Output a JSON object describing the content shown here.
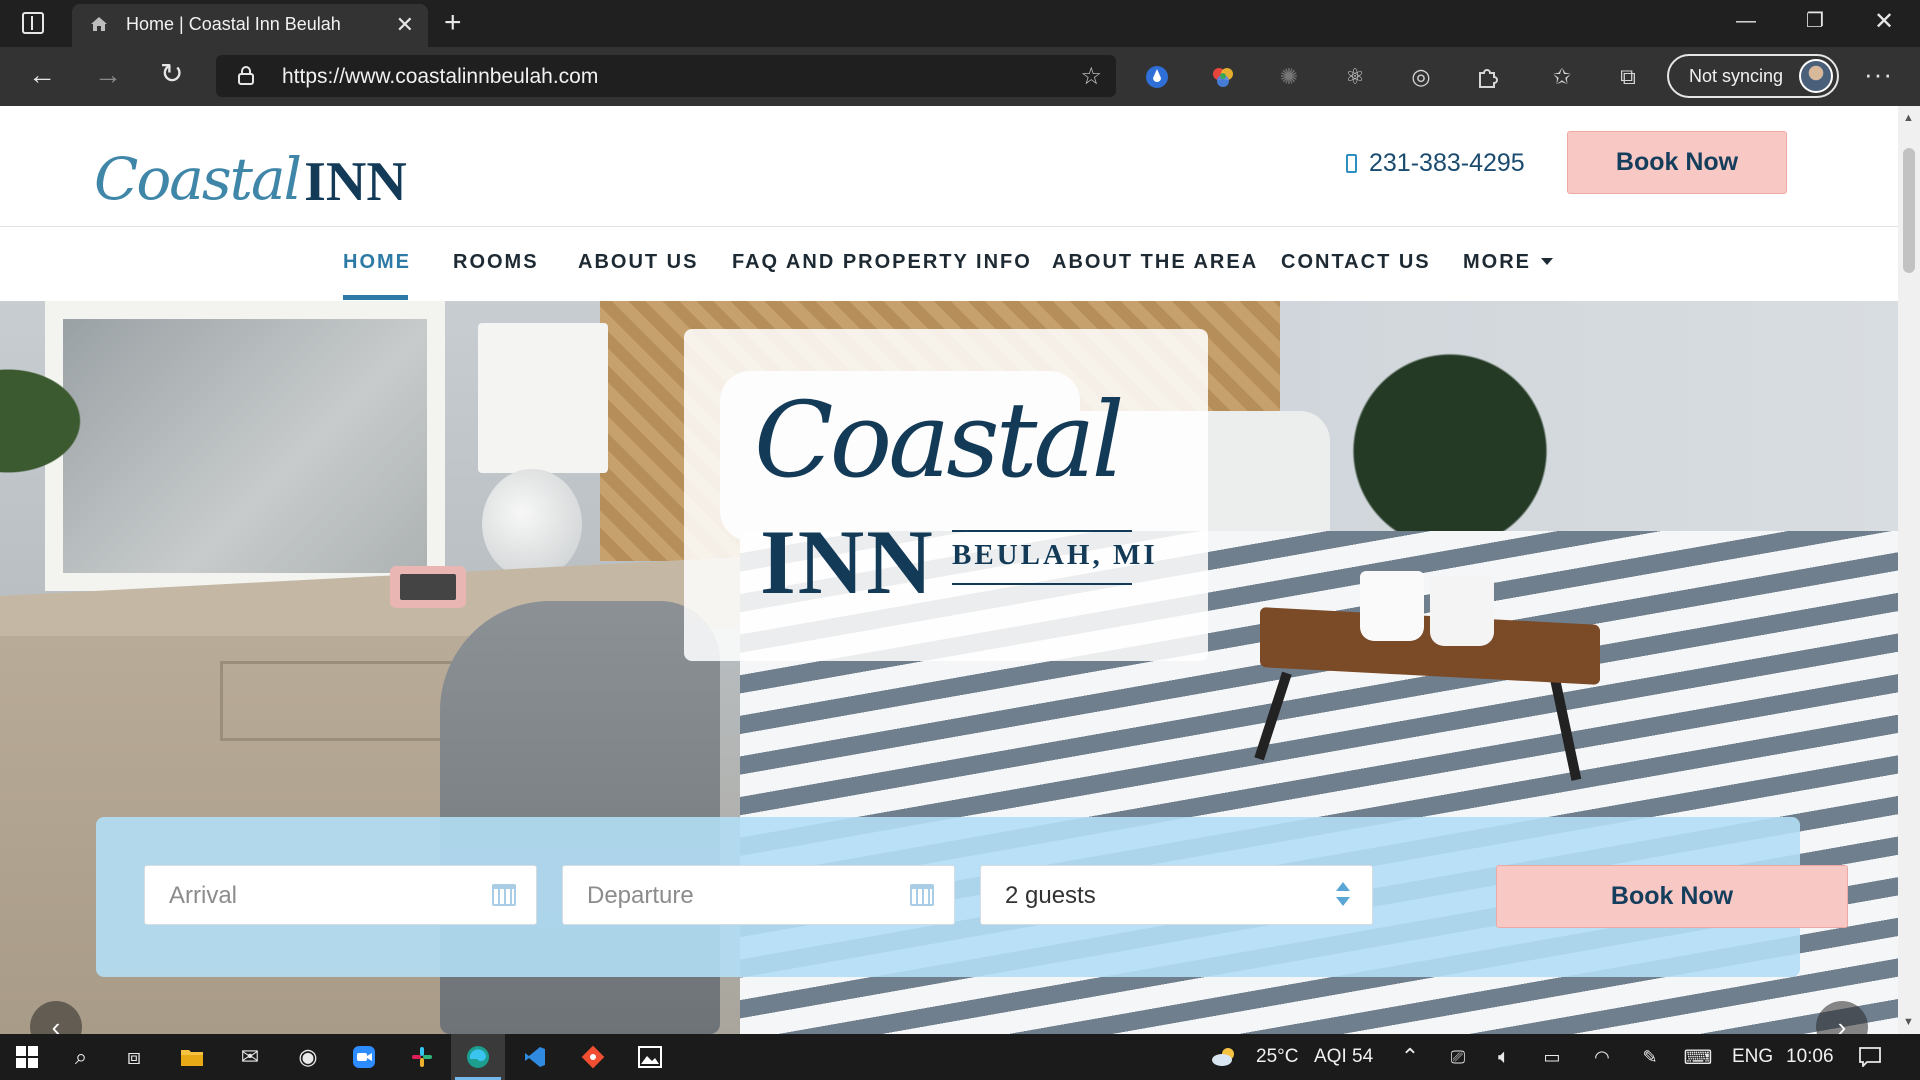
{
  "browser": {
    "tab_title": "Home | Coastal Inn Beulah",
    "url": "https://www.coastalinnbeulah.com",
    "sync_label": "Not syncing"
  },
  "site": {
    "logo_script": "Coastal",
    "logo_inn": "INN",
    "phone": "231-383-4295",
    "header_book_label": "Book Now",
    "nav": [
      {
        "label": "HOME",
        "active": true
      },
      {
        "label": "ROOMS"
      },
      {
        "label": "ABOUT US"
      },
      {
        "label": "FAQ AND PROPERTY INFO"
      },
      {
        "label": "ABOUT THE AREA"
      },
      {
        "label": "CONTACT US"
      },
      {
        "label": "MORE"
      }
    ],
    "hero_logo": {
      "script": "Coastal",
      "inn": "INN",
      "location": "BEULAH, MI"
    },
    "booking": {
      "arrival_placeholder": "Arrival",
      "departure_placeholder": "Departure",
      "guests_value": "2 guests",
      "book_label": "Book Now"
    }
  },
  "taskbar": {
    "weather": "25°C",
    "aqi": "AQI 54",
    "language": "ENG",
    "time": "10:06"
  },
  "colors": {
    "brand_navy": "#133a57",
    "brand_blue": "#2e7aa6",
    "book_pink": "#f8c8c5",
    "booking_bar": "#b2def5"
  }
}
